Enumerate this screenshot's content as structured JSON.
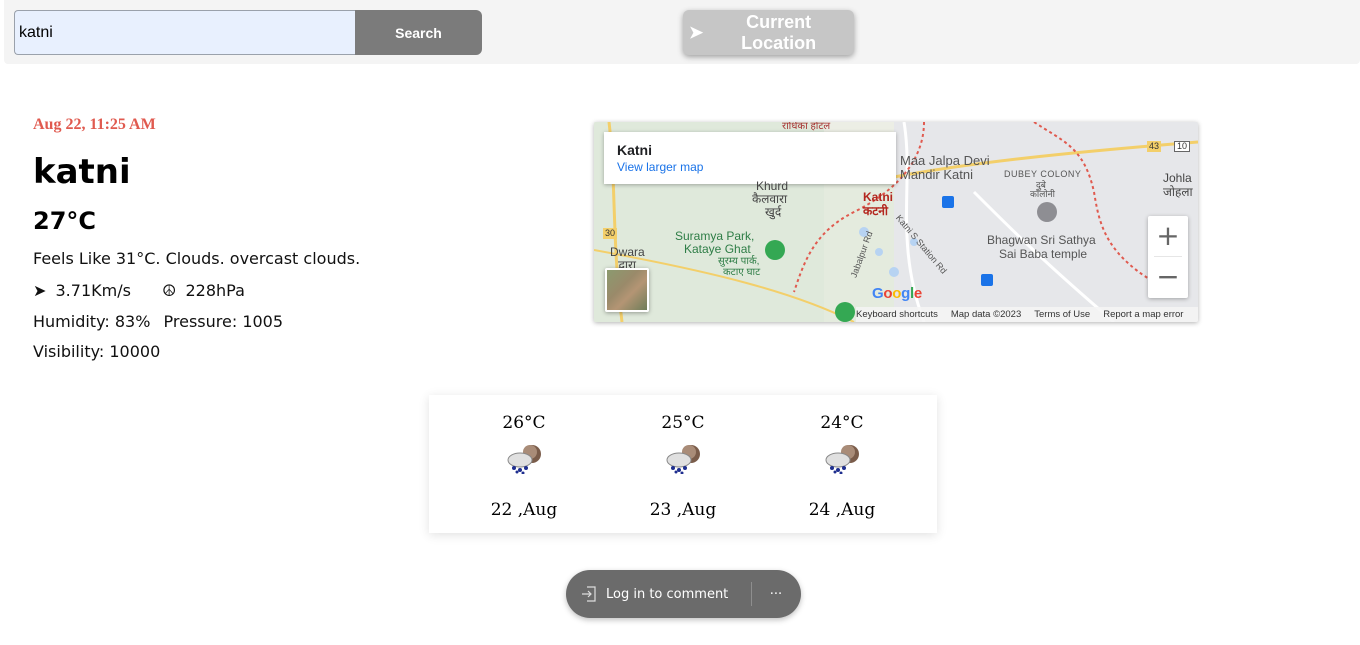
{
  "search": {
    "value": "katni",
    "button_label": "Search"
  },
  "current_location": {
    "icon": "arrow-icon",
    "label": "Current Location"
  },
  "weather": {
    "datetime": "Aug 22, 11:25 AM",
    "city": "katni",
    "temperature": "27°C",
    "summary": "Feels Like 31°C. Clouds. overcast clouds.",
    "wind": "3.71Km/s",
    "pressure_hpa": "228hPa",
    "humidity": "Humidity: 83%",
    "pressure": "Pressure: 1005",
    "visibility": "Visibility: 10000",
    "accent_color": "#e05a4f"
  },
  "map": {
    "place_title": "Katni",
    "view_larger_link": "View larger map",
    "labels": {
      "maa_jalpa_1": "Maa Jalpa Devi",
      "maa_jalpa_2": "Mandir Katni",
      "dubey_colony": "DUBEY COLONY",
      "dubey_colony_hi_1": "दुबे",
      "dubey_colony_hi_2": "कॉलोनी",
      "katni": "Katni",
      "katni_hi": "कटनी",
      "khurd_1": "Khurd",
      "khurd_2": "कैलवारा",
      "khurd_3": "खुर्द",
      "suramya_1": "Suramya Park,",
      "suramya_2": "Kataye Ghat",
      "suramya_hi_1": "सुरम्य पार्क,",
      "suramya_hi_2": "कटाए घाट",
      "dwara": "Dwara",
      "dwara_hi": "द्वारा",
      "bhagwan_1": "Bhagwan Sri Sathya",
      "bhagwan_2": "Sai Baba temple",
      "johla": "Johla",
      "johla_hi": "जोहला",
      "radhika": "राधिका होटल",
      "jabalpur_rd": "Jabalpur Rd",
      "station_rd": "Katni S Station Rd",
      "road_30": "30",
      "road_43": "43",
      "road_10": "10"
    },
    "google_logo": "Google",
    "attribution": [
      "Keyboard shortcuts",
      "Map data ©2023",
      "Terms of Use",
      "Report a map error"
    ],
    "zoom_in": "+",
    "zoom_out": "−"
  },
  "forecast": [
    {
      "temp": "26°C",
      "date": "22 ,Aug",
      "icon": "rain-cloud-icon"
    },
    {
      "temp": "25°C",
      "date": "23 ,Aug",
      "icon": "rain-cloud-icon"
    },
    {
      "temp": "24°C",
      "date": "24 ,Aug",
      "icon": "rain-cloud-icon"
    }
  ],
  "comment": {
    "login_label": "Log in to comment",
    "more_label": "···"
  }
}
